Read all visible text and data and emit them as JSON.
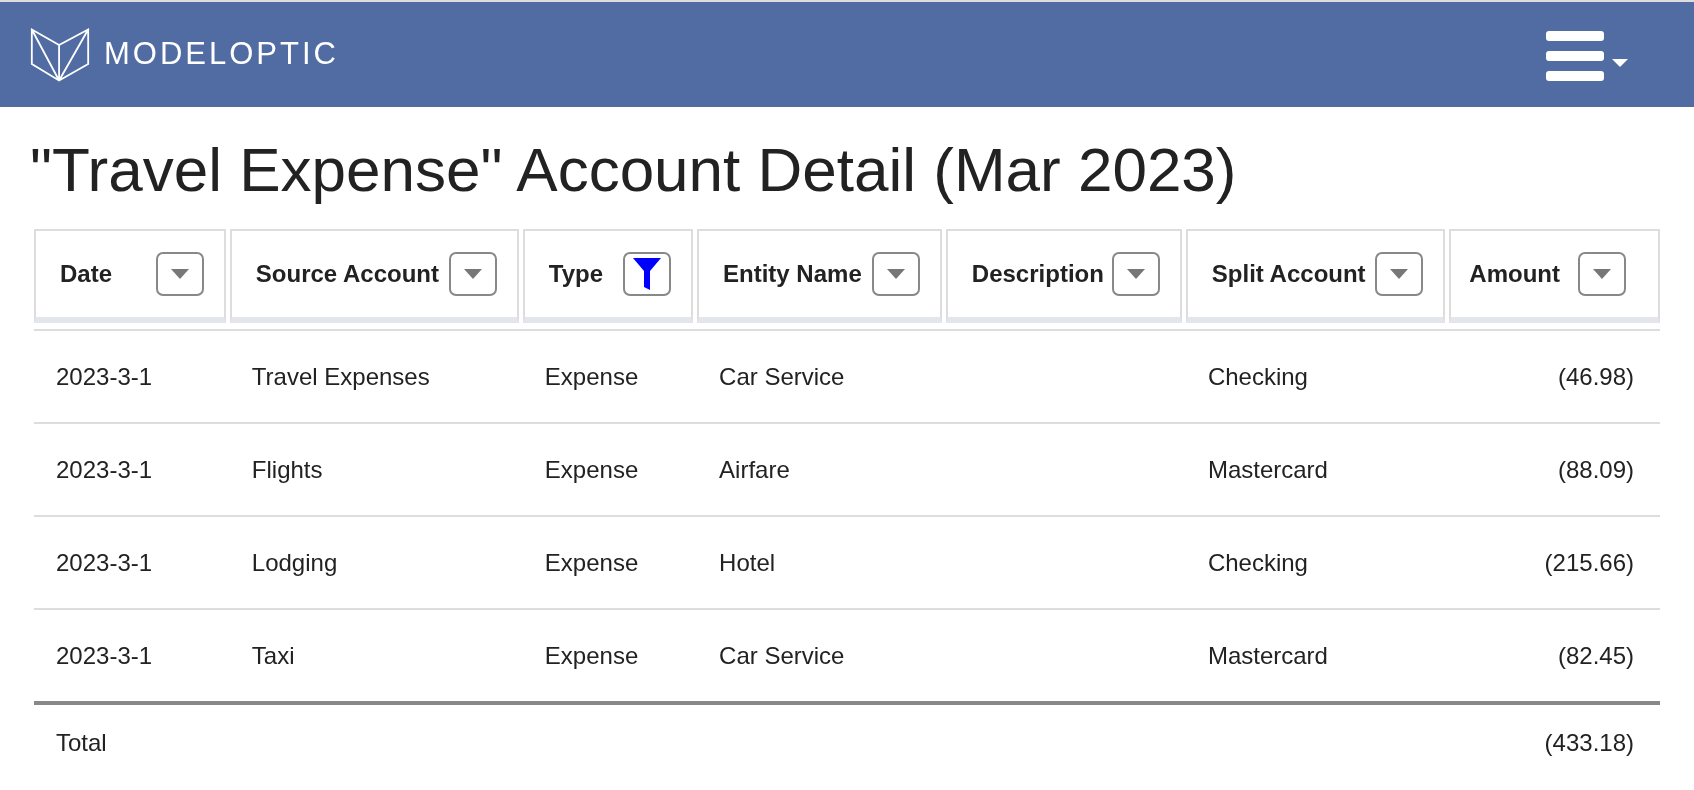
{
  "navbar": {
    "brand": "MODELOPTIC"
  },
  "title": "\"Travel Expense\" Account Detail (Mar 2023)",
  "table": {
    "columns": [
      {
        "label": "Date",
        "filtered": false
      },
      {
        "label": "Source Account",
        "filtered": false
      },
      {
        "label": "Type",
        "filtered": true
      },
      {
        "label": "Entity Name",
        "filtered": false
      },
      {
        "label": "Description",
        "filtered": false
      },
      {
        "label": "Split Account",
        "filtered": false
      },
      {
        "label": "Amount",
        "filtered": false
      }
    ],
    "rows": [
      [
        "2023-3-1",
        "Travel Expenses",
        "Expense",
        "Car Service",
        "",
        "Checking",
        "(46.98)"
      ],
      [
        "2023-3-1",
        "Flights",
        "Expense",
        "Airfare",
        "",
        "Mastercard",
        "(88.09)"
      ],
      [
        "2023-3-1",
        "Lodging",
        "Expense",
        "Hotel",
        "",
        "Checking",
        "(215.66)"
      ],
      [
        "2023-3-1",
        "Taxi",
        "Expense",
        "Car Service",
        "",
        "Mastercard",
        "(82.45)"
      ]
    ],
    "total": {
      "label": "Total",
      "amount": "(433.18)"
    }
  }
}
